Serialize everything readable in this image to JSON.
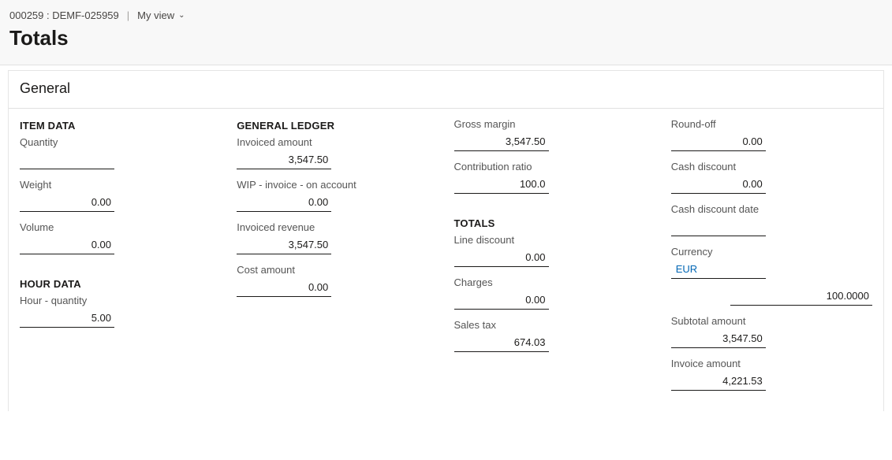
{
  "header": {
    "breadcrumb": "000259 : DEMF-025959",
    "view_label": "My view",
    "title": "Totals"
  },
  "panel": {
    "title": "General"
  },
  "item_data": {
    "heading": "ITEM DATA",
    "quantity_label": "Quantity",
    "quantity_value": "",
    "weight_label": "Weight",
    "weight_value": "0.00",
    "volume_label": "Volume",
    "volume_value": "0.00"
  },
  "hour_data": {
    "heading": "HOUR DATA",
    "hour_qty_label": "Hour - quantity",
    "hour_qty_value": "5.00"
  },
  "general_ledger": {
    "heading": "GENERAL LEDGER",
    "invoiced_amount_label": "Invoiced amount",
    "invoiced_amount_value": "3,547.50",
    "wip_label": "WIP - invoice - on account",
    "wip_value": "0.00",
    "invoiced_revenue_label": "Invoiced revenue",
    "invoiced_revenue_value": "3,547.50",
    "cost_amount_label": "Cost amount",
    "cost_amount_value": "0.00"
  },
  "margin": {
    "gross_margin_label": "Gross margin",
    "gross_margin_value": "3,547.50",
    "contribution_ratio_label": "Contribution ratio",
    "contribution_ratio_value": "100.0"
  },
  "totals": {
    "heading": "TOTALS",
    "line_discount_label": "Line discount",
    "line_discount_value": "0.00",
    "charges_label": "Charges",
    "charges_value": "0.00",
    "sales_tax_label": "Sales tax",
    "sales_tax_value": "674.03"
  },
  "col4": {
    "round_off_label": "Round-off",
    "round_off_value": "0.00",
    "cash_discount_label": "Cash discount",
    "cash_discount_value": "0.00",
    "cash_discount_date_label": "Cash discount date",
    "cash_discount_date_value": "",
    "currency_label": "Currency",
    "currency_value": "EUR",
    "rate_value": "100.0000",
    "subtotal_label": "Subtotal amount",
    "subtotal_value": "3,547.50",
    "invoice_amount_label": "Invoice amount",
    "invoice_amount_value": "4,221.53"
  }
}
